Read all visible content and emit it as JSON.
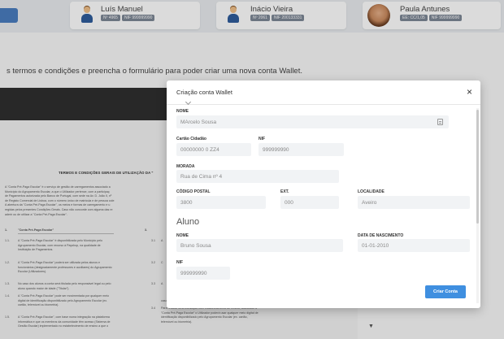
{
  "topbar": {
    "left_button": "",
    "users": [
      {
        "name": "Luís Manuel",
        "tags": [
          "Nº 4965",
          "NIF 999999990"
        ]
      },
      {
        "name": "Inácio Vieira",
        "tags": [
          "Nº 2061",
          "NIF 200133331"
        ]
      },
      {
        "name": "Paula Antunes",
        "tags": [
          "EE: CC/1,05",
          "NIF 999999990"
        ]
      }
    ]
  },
  "instructions": "s termos e condições e preencha o formulário para poder criar uma nova conta Wallet.",
  "document": {
    "title": "TERMOS E CONDIÇÕES GERAIS DE UTILIZAÇÃO DA \"",
    "intro_lines": [
      "A \"Conta Pré-Paga Escolar\" é o serviço de gestão de carregamentos associado a",
      "Município do Agrupamento Escolar, a que o Utilizador pertence, com a participaç",
      "de Pagamentos autorizada pelo Banco de Portugal, com sede na Av. D. João II, nº",
      "de Registo Comercial de Lisboa, com o número único de matrícula e de pessoa cole",
      "A abertura da \"Conta Pré-Paga Escolar\", os meios e formas de carregamento e u",
      "regidas pelos presentes Condições Gerais. Caso não concorde com alguma das re",
      "aderir ou de utilizar a \"Conta Pré-Paga Escolar\"."
    ],
    "sections": [
      {
        "num": "1.",
        "title": "\"Conta Pré-Paga Escolar\""
      },
      {
        "num": "1.1.",
        "text": "A \"Conta Pré-Paga Escolar\" é disponibilizada pelo Município pelo Agrupamento Escolar, com recurso à Payshop, na qualidade de Instituição de Pagamentos."
      },
      {
        "num": "1.2.",
        "text": "A \"Conta Pré-Paga Escolar\" poderá ser utilizada pelos alunos e funcionários (designadamente professores e auxiliares) do Agrupamento Escolar (Utilizadores)."
      },
      {
        "num": "1.3.",
        "text": "No caso dos alunos a conta será titulada pelo responsável legal ou pelo aluno quando maior de idade (\"Titular\")."
      },
      {
        "num": "1.4.",
        "text": "A \"Conta Pré-Paga Escolar\" pode ser movimentada por qualquer meio digital de identificação disponibilizado pelo Agrupamento Escolar (ex. cartão, telemóvel ou biometria)."
      },
      {
        "num": "1.5.",
        "text": "A \"Conta Pré-Paga Escolar\", com base numa integração na plataforma informática e que os membros da comunidade têm acesso (Sistema de Gestão Escolar) implementado no estabelecimento de ensino a que o"
      }
    ],
    "right_fragments": [
      {
        "num": "3.",
        "text": ""
      },
      {
        "num": "3.1",
        "text": "A"
      },
      {
        "num": "3.2",
        "text": "C"
      },
      {
        "num": "3.3",
        "text": "A"
      },
      {
        "num": "3.4",
        "text": "Para realizar uma transação num estabelecimento de ensino, associado à \"Conta Pré-Paga Escolar\" o Utilizador poderá usar qualquer meio digital de identificação disponibilizado pelo Agrupamento Escolar (ex. cartão, telemóvel ou biometria)."
      }
    ],
    "right_extra": "caso algum, dependência através a correr."
  },
  "modal": {
    "title": "Criação conta Wallet",
    "close_symbol": "×",
    "fields": {
      "nome_label": "NOME",
      "nome_value": "MArcelo Sousa",
      "cc_label": "Cartão Cidadão",
      "cc_value": "00000000 0 ZZ4",
      "nif_label": "NIF",
      "nif_value": "999999990",
      "morada_label": "MORADA",
      "morada_value": "Rua de Cima nº 4",
      "cp_label": "CÓDIGO POSTAL",
      "cp_value": "3800",
      "ext_label": "EXT.",
      "ext_value": "000",
      "loc_label": "LOCALIDADE",
      "loc_value": "Aveiro"
    },
    "aluno": {
      "heading": "Aluno",
      "nome_label": "NOME",
      "nome_value": "Bruno Sousa",
      "dn_label": "DATA DE NASCIMENTO",
      "dn_value": "01-01-2010",
      "nif_label": "NIF",
      "nif_value": "999999990"
    },
    "submit_label": "Criar Conta"
  }
}
